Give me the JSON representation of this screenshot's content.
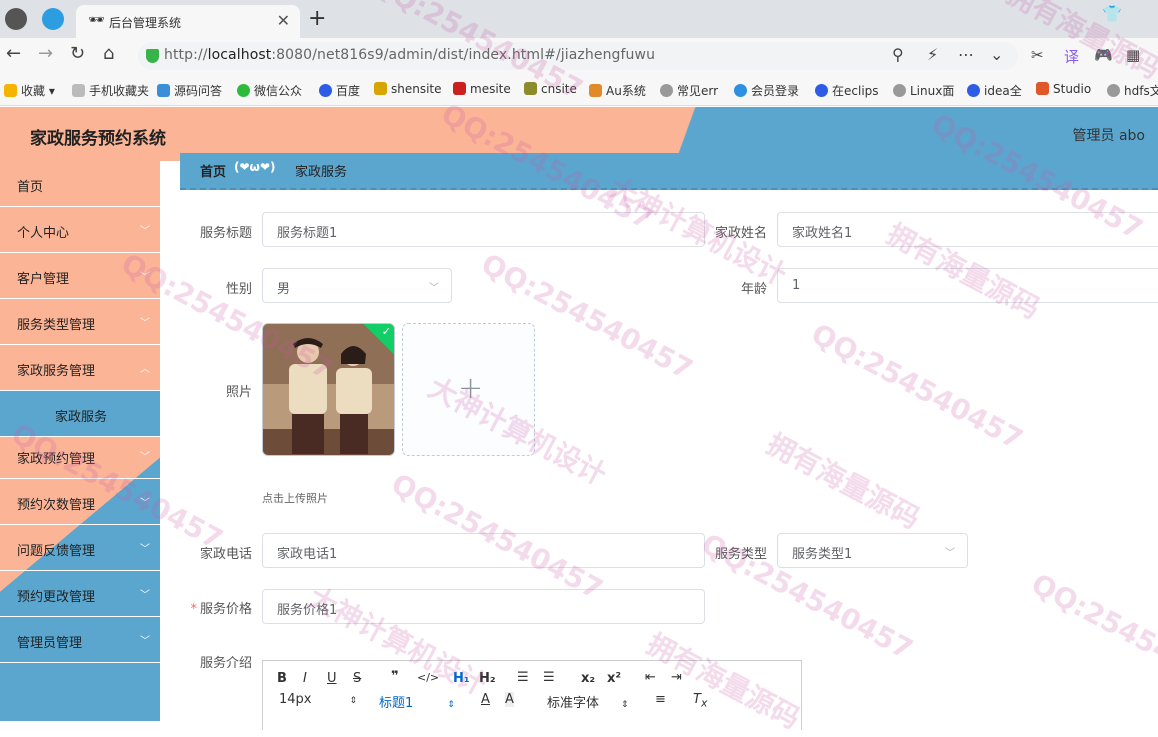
{
  "browser": {
    "tab_title": "后台管理系统",
    "url_prefix": "http://",
    "url_host": "localhost",
    "url_rest": ":8080/net816s9/admin/dist/index.html#/jiazhengfuwu",
    "bookmarks": [
      "收藏",
      "手机收藏夹",
      "源码问答",
      "微信公众",
      "百度",
      "shensite",
      "mesite",
      "cnsite",
      "Au系统",
      "常见err",
      "会员登录",
      "在eclips",
      "Linux面",
      "idea全",
      "Studio",
      "hdfs文"
    ]
  },
  "header": {
    "title": "家政服务预约系统",
    "user": "管理员 abo"
  },
  "sidebar": {
    "items": [
      {
        "label": "首页"
      },
      {
        "label": "个人中心"
      },
      {
        "label": "客户管理"
      },
      {
        "label": "服务类型管理"
      },
      {
        "label": "家政服务管理"
      },
      {
        "label": "家政服务"
      },
      {
        "label": "家政预约管理"
      },
      {
        "label": "预约次数管理"
      },
      {
        "label": "问题反馈管理"
      },
      {
        "label": "预约更改管理"
      },
      {
        "label": "管理员管理"
      }
    ]
  },
  "breadcrumb": {
    "home": "首页",
    "separator": "(❤ω❤)",
    "current": "家政服务"
  },
  "form": {
    "title_label": "服务标题",
    "title_value": "服务标题1",
    "name_label": "家政姓名",
    "name_value": "家政姓名1",
    "gender_label": "性别",
    "gender_value": "男",
    "age_label": "年龄",
    "age_value": "1",
    "photo_label": "照片",
    "photo_tip": "点击上传照片",
    "phone_label": "家政电话",
    "phone_value": "家政电话1",
    "type_label": "服务类型",
    "type_value": "服务类型1",
    "price_label": "服务价格",
    "price_value": "服务价格1",
    "intro_label": "服务介绍"
  },
  "editor": {
    "font_size": "14px",
    "heading": "标题1",
    "font_family": "标准字体"
  },
  "watermarks": [
    "大神计算机设计",
    "QQ:254540457",
    "拥有海量源码"
  ]
}
